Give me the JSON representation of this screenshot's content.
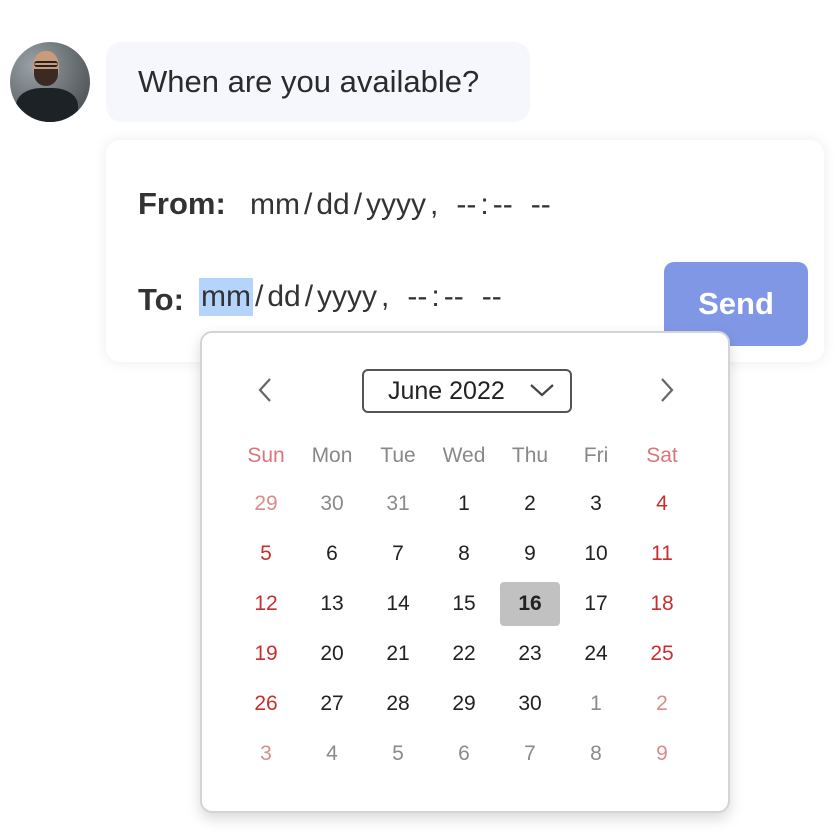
{
  "chat": {
    "message": "When are you available?"
  },
  "form": {
    "from_label": "From:",
    "to_label": "To:",
    "placeholder": {
      "month": "mm",
      "day": "dd",
      "year": "yyyy",
      "hour": "--",
      "minute": "--",
      "ampm": "--",
      "date_sep": "/",
      "comma": ",",
      "time_sep": ":"
    },
    "send_label": "Send"
  },
  "calendar": {
    "month_label": "June 2022",
    "weekdays": [
      "Sun",
      "Mon",
      "Tue",
      "Wed",
      "Thu",
      "Fri",
      "Sat"
    ],
    "weeks": [
      [
        "29",
        "30",
        "31",
        "1",
        "2",
        "3",
        "4"
      ],
      [
        "5",
        "6",
        "7",
        "8",
        "9",
        "10",
        "11"
      ],
      [
        "12",
        "13",
        "14",
        "15",
        "16",
        "17",
        "18"
      ],
      [
        "19",
        "20",
        "21",
        "22",
        "23",
        "24",
        "25"
      ],
      [
        "26",
        "27",
        "28",
        "29",
        "30",
        "1",
        "2"
      ],
      [
        "3",
        "4",
        "5",
        "6",
        "7",
        "8",
        "9"
      ]
    ],
    "today": "16"
  },
  "colors": {
    "send_button": "#8097e6",
    "weekend_text": "#c7302e",
    "selection_highlight": "#b4d4fb",
    "today_background": "#c1c1c1"
  },
  "icons": {
    "prev": "chevron-left-icon",
    "next": "chevron-right-icon",
    "dropdown": "chevron-down-icon"
  }
}
